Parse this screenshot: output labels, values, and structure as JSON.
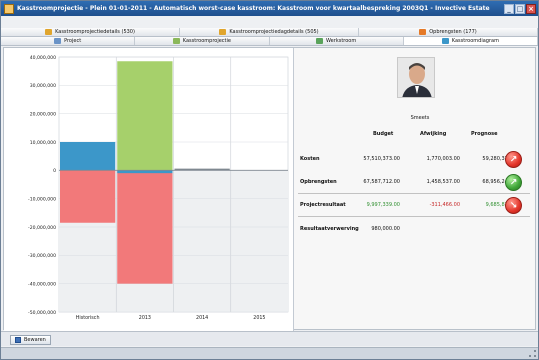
{
  "window": {
    "title": "Kasstroomprojectie - Plein 01-01-2011 - Automatisch worst-case kasstroom: Kasstroom voor kwartaalbespreking 2003Q1 - Invective Estate"
  },
  "tabs_top": [
    {
      "label": "Kasstroomprojectiedetails (530)",
      "icon": "folder-icon"
    },
    {
      "label": "Kasstroomprojectiedagdetails (505)",
      "icon": "folder-icon"
    },
    {
      "label": "Opbrengsten (177)",
      "icon": "money-icon"
    }
  ],
  "tabs_bottom": [
    {
      "label": "Project",
      "icon": "project-icon"
    },
    {
      "label": "Kasstroomprojectie",
      "icon": "projection-icon"
    },
    {
      "label": "Werkstroom",
      "icon": "workflow-icon"
    },
    {
      "label": "Kasstroomdiagram",
      "icon": "chart-icon"
    }
  ],
  "chart_data": {
    "type": "bar",
    "categories": [
      "Historisch",
      "2013",
      "2014",
      "2015"
    ],
    "ylim": [
      -50000000,
      40000000
    ],
    "yticks": [
      "40,000,000",
      "30,000,000",
      "20,000,000",
      "10,000,000",
      "0",
      "-10,000,000",
      "-20,000,000",
      "-30,000,000",
      "-40,000,000",
      "-50,000,000"
    ],
    "colors": {
      "green": "#a6d06b",
      "blue": "#3c97c9",
      "red": "#f2797a",
      "gray": "#7f8891"
    },
    "segments": [
      {
        "category": "Historisch",
        "from": 0,
        "to": 10000000,
        "color": "blue"
      },
      {
        "category": "Historisch",
        "from": 0,
        "to": -18500000,
        "color": "red"
      },
      {
        "category": "2013",
        "from": 0,
        "to": 38500000,
        "color": "green"
      },
      {
        "category": "2013",
        "from": 0,
        "to": -40000000,
        "color": "red"
      },
      {
        "category": "2013",
        "from": 0,
        "to": -1000000,
        "color": "blue"
      },
      {
        "category": "2014",
        "from": 0,
        "to": 600000,
        "color": "gray"
      }
    ]
  },
  "person": {
    "name": "Smeets"
  },
  "table": {
    "headers": [
      "Budget",
      "Afwijking",
      "Prognose"
    ],
    "rows": [
      {
        "label": "Kosten",
        "budget": "57,510,373.00",
        "afwijking": "1,770,003.00",
        "prognose": "59,280,376.00",
        "status": "red-arrow-icon",
        "arrow": "↗"
      },
      {
        "label": "Opbrengsten",
        "budget": "67,587,712.00",
        "afwijking": "1,458,537.00",
        "prognose": "68,956,249.00",
        "status": "green-arrow-icon",
        "arrow": "↗"
      },
      {
        "label": "Projectresultaat",
        "budget": "9,997,339.00",
        "afwijking": "-311,466.00",
        "prognose": "9,685,873.00",
        "status": "red-arrow-icon",
        "arrow": "↘"
      },
      {
        "label": "Resultaatverwerving",
        "budget": "980,000.00"
      }
    ]
  },
  "bottom_bar": {
    "save_label": "Bewaren"
  }
}
